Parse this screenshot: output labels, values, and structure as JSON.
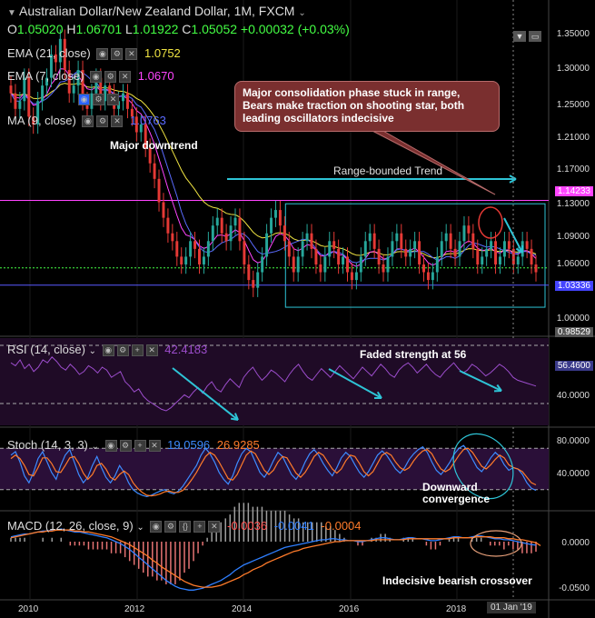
{
  "header": {
    "symbol": "Australian Dollar/New Zealand Dollar, 1M, FXCM",
    "ohlc": {
      "o": "1.05020",
      "h": "1.06701",
      "l": "1.01922",
      "c": "1.05052",
      "chg": "+0.00032 (+0.03%)"
    }
  },
  "indicators": {
    "ema21": {
      "label": "EMA (21, close)",
      "value": "1.0752"
    },
    "ema7": {
      "label": "EMA (7, close)",
      "value": "1.0670"
    },
    "ma9": {
      "label": "MA (9, close)",
      "value": "1.0763"
    }
  },
  "colors": {
    "up": "#26a69a",
    "down": "#e53935",
    "ema21": "#f0e442",
    "ema7": "#ff9800",
    "ma9": "#5b6bff",
    "rsi": "#9c4dcc",
    "stochK": "#3d8bff",
    "stochD": "#ff7b2a",
    "macd": "#2f7fff",
    "signal": "#ff7b2a",
    "annot": "#2ec4d6",
    "pink": "#ff44ff",
    "blueline": "#5a5aff",
    "green": "#44ff44",
    "callout": "#7a2f2f"
  },
  "annotations": {
    "callout": "Major consolidation phase stuck in range, Bears make traction on shooting star, both leading oscillators indecisive",
    "downtrend": "Major downtrend",
    "range": "Range-bounded Trend",
    "rsi_note": "Faded strength at 56",
    "stoch_note": "Downward\nconvergence",
    "macd_note": "Indecisive bearish crossover"
  },
  "chart_data": [
    {
      "type": "candlestick",
      "title": "Australian Dollar/New Zealand Dollar, 1M, FXCM",
      "ylim": [
        0.97,
        1.4
      ],
      "yticks": [
        "1.35000",
        "1.30000",
        "1.25000",
        "1.21000",
        "1.17000",
        "1.13000",
        "1.09000",
        "1.06000",
        "1.03000",
        "1.00000"
      ],
      "price_tags": [
        {
          "label": "1.14233",
          "value": 1.14233,
          "color": "#ff44ff"
        },
        {
          "label": "1.03336",
          "value": 1.03336,
          "color": "#5a5aff"
        },
        {
          "label": "0.98529",
          "value": 0.98529,
          "color": "#444"
        }
      ],
      "xticks": [
        "2010",
        "2012",
        "2014",
        "2016",
        "2018"
      ],
      "date_tag": "01 Jan '19",
      "range_box": {
        "top": 1.138,
        "bottom": 1.005
      },
      "support_line": 1.0556,
      "closes": [
        1.28,
        1.26,
        1.27,
        1.3,
        1.25,
        1.24,
        1.27,
        1.29,
        1.3,
        1.33,
        1.32,
        1.35,
        1.31,
        1.28,
        1.29,
        1.31,
        1.27,
        1.26,
        1.28,
        1.3,
        1.27,
        1.29,
        1.28,
        1.26,
        1.27,
        1.28,
        1.26,
        1.25,
        1.23,
        1.24,
        1.21,
        1.19,
        1.17,
        1.14,
        1.12,
        1.1,
        1.09,
        1.07,
        1.06,
        1.07,
        1.09,
        1.08,
        1.06,
        1.07,
        1.09,
        1.11,
        1.12,
        1.1,
        1.09,
        1.11,
        1.12,
        1.09,
        1.06,
        1.04,
        1.03,
        1.05,
        1.07,
        1.1,
        1.12,
        1.13,
        1.11,
        1.09,
        1.07,
        1.05,
        1.07,
        1.09,
        1.1,
        1.08,
        1.06,
        1.05,
        1.07,
        1.09,
        1.08,
        1.06,
        1.07,
        1.05,
        1.04,
        1.05,
        1.07,
        1.09,
        1.1,
        1.08,
        1.06,
        1.05,
        1.07,
        1.09,
        1.1,
        1.08,
        1.07,
        1.08,
        1.09,
        1.06,
        1.05,
        1.04,
        1.05,
        1.07,
        1.09,
        1.1,
        1.08,
        1.07,
        1.09,
        1.11,
        1.1,
        1.08,
        1.06,
        1.07,
        1.08,
        1.09,
        1.06,
        1.07,
        1.09,
        1.08,
        1.06,
        1.07,
        1.09,
        1.08,
        1.06,
        1.05
      ]
    },
    {
      "type": "line",
      "title": "RSI (14, close)",
      "value": "42.4183",
      "ylim": [
        15,
        75
      ],
      "yticks": [
        "40.0000"
      ],
      "levels": [
        70,
        30
      ],
      "last_tag": "56.4600",
      "values": [
        58,
        56,
        60,
        54,
        57,
        52,
        55,
        60,
        58,
        62,
        59,
        55,
        53,
        57,
        54,
        50,
        52,
        56,
        54,
        51,
        55,
        53,
        48,
        50,
        52,
        45,
        42,
        38,
        40,
        35,
        32,
        30,
        28,
        26,
        25,
        27,
        30,
        33,
        36,
        34,
        38,
        41,
        37,
        42,
        45,
        40,
        38,
        43,
        47,
        44,
        41,
        48,
        52,
        55,
        50,
        46,
        49,
        53,
        51,
        48,
        45,
        50,
        54,
        57,
        52,
        48,
        46,
        50,
        54,
        51,
        48,
        52,
        56,
        53,
        50,
        47,
        51,
        55,
        52,
        49,
        53,
        57,
        54,
        50,
        48,
        53,
        56,
        58,
        55,
        51,
        54,
        57,
        53,
        50,
        48,
        52,
        55,
        58,
        54,
        51,
        53,
        57,
        55,
        52,
        49,
        51,
        54,
        57,
        55,
        52,
        48,
        46,
        45,
        44,
        43,
        42
      ]
    },
    {
      "type": "line",
      "title": "Stoch (14, 3, 3)",
      "values_text": [
        "19.0596",
        "26.9285"
      ],
      "ylim": [
        0,
        100
      ],
      "yticks": [
        "80.0000",
        "40.0000"
      ],
      "levels": [
        80,
        20
      ],
      "series": [
        {
          "name": "K",
          "values": [
            70,
            75,
            60,
            40,
            30,
            45,
            65,
            75,
            60,
            45,
            35,
            55,
            70,
            78,
            60,
            42,
            30,
            38,
            55,
            68,
            52,
            38,
            30,
            40,
            55,
            45,
            30,
            20,
            15,
            12,
            10,
            12,
            15,
            18,
            20,
            16,
            14,
            18,
            25,
            35,
            45,
            55,
            70,
            80,
            72,
            60,
            45,
            35,
            28,
            40,
            58,
            72,
            80,
            75,
            60,
            45,
            38,
            48,
            62,
            74,
            68,
            55,
            42,
            35,
            45,
            60,
            72,
            78,
            70,
            58,
            48,
            40,
            52,
            66,
            74,
            68,
            56,
            45,
            38,
            46,
            58,
            70,
            76,
            70,
            60,
            50,
            44,
            52,
            64,
            72,
            78,
            82,
            74,
            60,
            48,
            42,
            50,
            60,
            72,
            80,
            84,
            76,
            64,
            52,
            46,
            55,
            66,
            74,
            68,
            56,
            48,
            52,
            50,
            42,
            30,
            22,
            19
          ]
        },
        {
          "name": "D",
          "values": [
            65,
            70,
            65,
            55,
            42,
            40,
            52,
            66,
            66,
            58,
            46,
            45,
            55,
            66,
            68,
            58,
            44,
            35,
            42,
            55,
            58,
            50,
            38,
            34,
            42,
            47,
            42,
            30,
            22,
            16,
            12,
            11,
            12,
            14,
            17,
            18,
            16,
            16,
            19,
            26,
            35,
            45,
            57,
            68,
            74,
            70,
            60,
            48,
            36,
            34,
            42,
            56,
            70,
            76,
            72,
            60,
            48,
            42,
            48,
            60,
            68,
            66,
            55,
            44,
            38,
            45,
            56,
            68,
            74,
            70,
            60,
            50,
            44,
            50,
            62,
            70,
            68,
            58,
            46,
            40,
            46,
            58,
            70,
            74,
            70,
            60,
            52,
            48,
            52,
            62,
            70,
            76,
            78,
            72,
            60,
            50,
            46,
            50,
            60,
            70,
            78,
            80,
            74,
            64,
            54,
            50,
            56,
            64,
            70,
            66,
            56,
            52,
            50,
            46,
            38,
            30,
            27
          ]
        }
      ]
    },
    {
      "type": "bar+line",
      "title": "MACD (12, 26, close, 9)",
      "values_text": [
        "-0.0036",
        "-0.0041",
        "-0.0004"
      ],
      "ylim": [
        -0.06,
        0.03
      ],
      "yticks": [
        "0.0000",
        "-0.0500"
      ],
      "series": [
        {
          "name": "MACD",
          "values": [
            0.005,
            0.006,
            0.007,
            0.008,
            0.008,
            0.009,
            0.01,
            0.011,
            0.011,
            0.012,
            0.012,
            0.013,
            0.012,
            0.011,
            0.01,
            0.01,
            0.009,
            0.008,
            0.007,
            0.006,
            0.005,
            0.004,
            0.002,
            0.0,
            -0.002,
            -0.005,
            -0.008,
            -0.012,
            -0.016,
            -0.02,
            -0.024,
            -0.028,
            -0.032,
            -0.036,
            -0.04,
            -0.043,
            -0.046,
            -0.048,
            -0.049,
            -0.05,
            -0.05,
            -0.049,
            -0.048,
            -0.046,
            -0.044,
            -0.042,
            -0.04,
            -0.037,
            -0.034,
            -0.03,
            -0.027,
            -0.024,
            -0.022,
            -0.02,
            -0.018,
            -0.016,
            -0.014,
            -0.012,
            -0.01,
            -0.008,
            -0.006,
            -0.005,
            -0.004,
            -0.003,
            -0.002,
            -0.001,
            0.0,
            0.001,
            0.002,
            0.002,
            0.003,
            0.003,
            0.002,
            0.002,
            0.001,
            0.001,
            0.0,
            0.0,
            0.001,
            0.002,
            0.003,
            0.004,
            0.004,
            0.003,
            0.002,
            0.002,
            0.003,
            0.004,
            0.004,
            0.003,
            0.003,
            0.002,
            0.001,
            0.001,
            0.002,
            0.003,
            0.004,
            0.005,
            0.005,
            0.004,
            0.004,
            0.005,
            0.006,
            0.006,
            0.005,
            0.004,
            0.003,
            0.003,
            0.002,
            0.002,
            0.001,
            0.0,
            -0.001,
            -0.002,
            -0.003,
            -0.0036
          ]
        },
        {
          "name": "Signal",
          "values": [
            0.004,
            0.005,
            0.006,
            0.007,
            0.008,
            0.009,
            0.01,
            0.01,
            0.011,
            0.011,
            0.012,
            0.012,
            0.012,
            0.012,
            0.011,
            0.011,
            0.01,
            0.01,
            0.009,
            0.008,
            0.007,
            0.006,
            0.005,
            0.003,
            0.001,
            -0.001,
            -0.003,
            -0.006,
            -0.009,
            -0.012,
            -0.015,
            -0.019,
            -0.022,
            -0.026,
            -0.029,
            -0.032,
            -0.035,
            -0.038,
            -0.041,
            -0.043,
            -0.045,
            -0.046,
            -0.047,
            -0.047,
            -0.047,
            -0.046,
            -0.045,
            -0.043,
            -0.041,
            -0.039,
            -0.037,
            -0.034,
            -0.032,
            -0.029,
            -0.027,
            -0.025,
            -0.022,
            -0.02,
            -0.018,
            -0.016,
            -0.014,
            -0.012,
            -0.01,
            -0.009,
            -0.007,
            -0.006,
            -0.005,
            -0.004,
            -0.003,
            -0.002,
            -0.001,
            0.0,
            0.0,
            0.001,
            0.001,
            0.001,
            0.001,
            0.001,
            0.001,
            0.001,
            0.002,
            0.002,
            0.002,
            0.002,
            0.002,
            0.002,
            0.002,
            0.003,
            0.003,
            0.003,
            0.003,
            0.003,
            0.003,
            0.003,
            0.003,
            0.003,
            0.003,
            0.004,
            0.004,
            0.004,
            0.004,
            0.004,
            0.005,
            0.005,
            0.005,
            0.005,
            0.004,
            0.004,
            0.004,
            0.003,
            0.003,
            0.002,
            0.002,
            0.001,
            0.0,
            -0.001,
            -0.0041
          ]
        }
      ]
    }
  ]
}
